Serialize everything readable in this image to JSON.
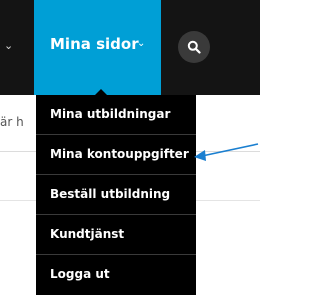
{
  "nav": {
    "active_label": "Mina sidor",
    "active_color": "#009fd6",
    "bar_color": "#141414",
    "search_icon": "search-icon"
  },
  "page": {
    "partial_text": "är h"
  },
  "dropdown": {
    "items": [
      {
        "label": "Mina utbildningar"
      },
      {
        "label": "Mina kontouppgifter"
      },
      {
        "label": "Beställ utbildning"
      },
      {
        "label": "Kundtjänst"
      },
      {
        "label": "Logga ut"
      }
    ]
  },
  "annotation": {
    "arrow_color": "#1a7fd0",
    "points_to": "Mina kontouppgifter"
  }
}
